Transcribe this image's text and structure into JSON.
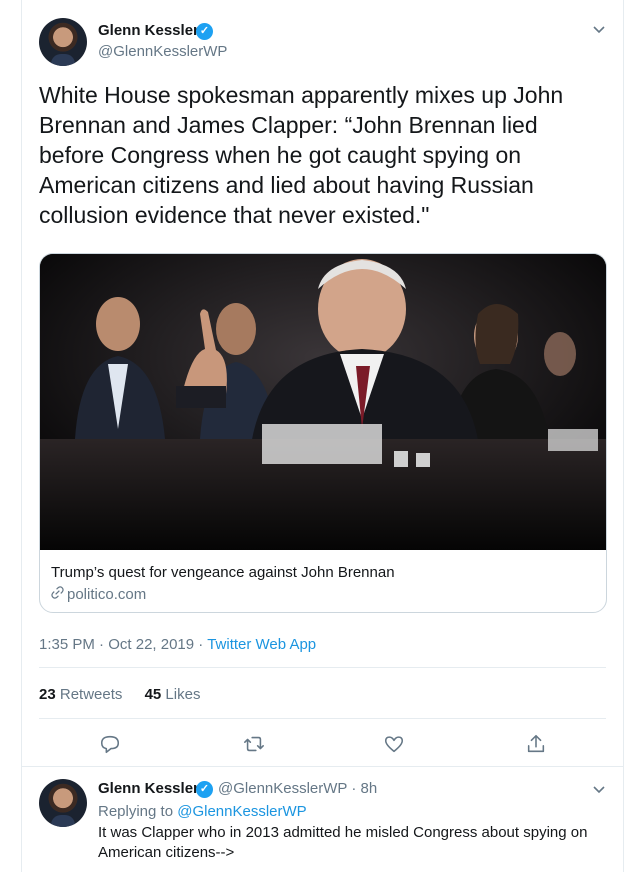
{
  "tweet": {
    "author_name": "Glenn Kessler",
    "author_handle": "@GlennKesslerWP",
    "text": "White House spokesman apparently mixes up John Brennan and James Clapper: “John Brennan lied before Congress when he got caught spying on American citizens and lied about having Russian collusion evidence that never existed.\"",
    "card": {
      "title": "Trump’s quest for vengeance against John Brennan",
      "domain": "politico.com"
    },
    "time": "1:35 PM",
    "date": "Oct 22, 2019",
    "source_app": "Twitter Web App",
    "retweets_count": "23",
    "retweets_label": "Retweets",
    "likes_count": "45",
    "likes_label": "Likes",
    "separator": "·"
  },
  "reply": {
    "author_name": "Glenn Kessler",
    "author_handle": "@GlennKesslerWP",
    "time_ago": "8h",
    "replying_to_label": "Replying to",
    "replying_to_handle": "@GlennKesslerWP",
    "text": "It was Clapper who in 2013 admitted he misled Congress about spying on American citizens-->"
  },
  "colors": {
    "accent": "#1da1f2",
    "link": "#1b95e0",
    "muted": "#657786",
    "border": "#e6ecf0"
  },
  "icons": [
    "verified-icon",
    "chevron-down-icon",
    "link-icon",
    "reply-icon",
    "retweet-icon",
    "like-icon",
    "share-icon"
  ]
}
